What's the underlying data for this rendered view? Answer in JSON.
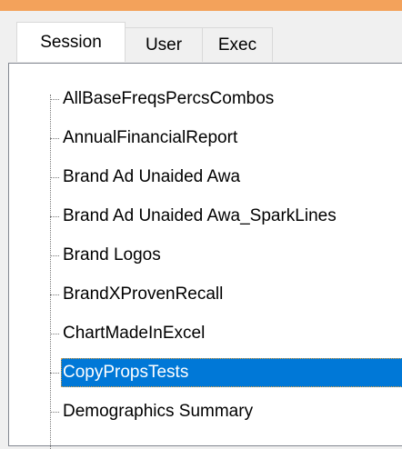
{
  "accent_color": "#f3a25b",
  "selection_color": "#0078d7",
  "tabs": [
    {
      "label": "Session",
      "active": true
    },
    {
      "label": "User",
      "active": false
    },
    {
      "label": "Exec",
      "active": false
    }
  ],
  "tree": {
    "items": [
      {
        "label": "AllBaseFreqsPercsCombos",
        "selected": false
      },
      {
        "label": "AnnualFinancialReport",
        "selected": false
      },
      {
        "label": "Brand Ad Unaided Awa",
        "selected": false
      },
      {
        "label": "Brand Ad Unaided Awa_SparkLines",
        "selected": false
      },
      {
        "label": "Brand Logos",
        "selected": false
      },
      {
        "label": "BrandXProvenRecall",
        "selected": false
      },
      {
        "label": "ChartMadeInExcel",
        "selected": false
      },
      {
        "label": "CopyPropsTests",
        "selected": true
      },
      {
        "label": "Demographics Summary",
        "selected": false
      }
    ]
  }
}
